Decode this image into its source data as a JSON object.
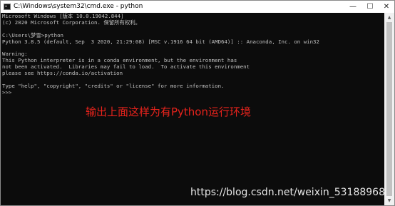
{
  "window": {
    "title": "C:\\Windows\\system32\\cmd.exe - python",
    "controls": {
      "minimize": "—",
      "maximize": "☐",
      "close": "✕"
    }
  },
  "console": {
    "lines": [
      "Microsoft Windows [版本 10.0.19042.844]",
      "(c) 2020 Microsoft Corporation. 保留所有权利。",
      "",
      "C:\\Users\\梦雪>python",
      "Python 3.8.5 (default, Sep  3 2020, 21:29:08) [MSC v.1916 64 bit (AMD64)] :: Anaconda, Inc. on win32",
      "",
      "Warning:",
      "This Python interpreter is in a conda environment, but the environment has",
      "not been activated.  Libraries may fail to load.  To activate this environment",
      "please see https://conda.io/activation",
      "",
      "Type \"help\", \"copyright\", \"credits\" or \"license\" for more information.",
      ">>>"
    ]
  },
  "annotation": "输出上面这样为有Python运行环境",
  "watermark": "https://blog.csdn.net/weixin_53188968",
  "scrollbar": {
    "up_icon": "▲",
    "down_icon": "▼"
  },
  "colors": {
    "console_bg": "#0c0c0c",
    "console_text": "#c0c0c0",
    "annotation": "#e8231c"
  }
}
